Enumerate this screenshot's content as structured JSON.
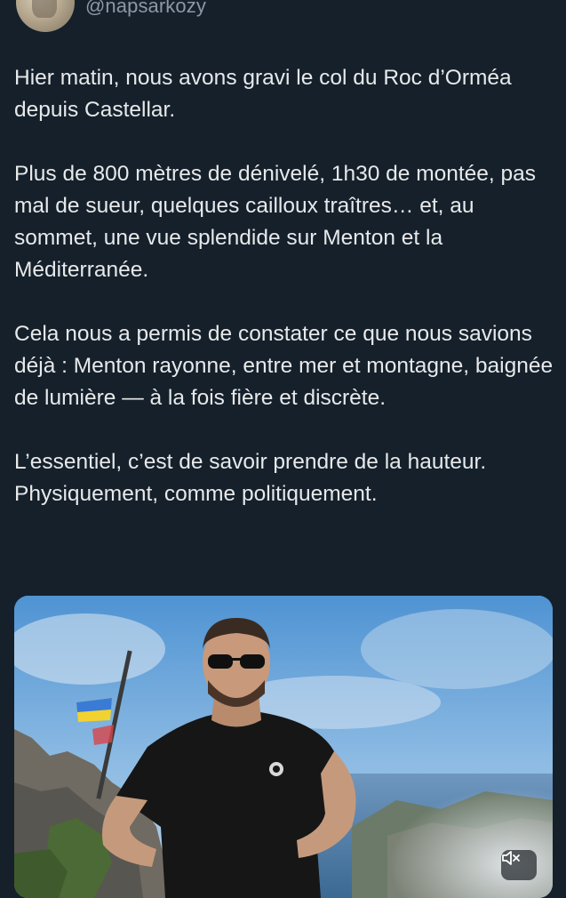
{
  "author": {
    "handle": "@napsarkozy",
    "avatar_icon": "profile-avatar"
  },
  "tweet": {
    "paragraphs": [
      "Hier matin, nous avons gravi le col du Roc d’Orméa depuis Castellar.",
      "Plus de 800 mètres de dénivelé, 1h30 de montée, pas mal de sueur, quelques cailloux traîtres… et, au sommet, une vue splendide sur Menton et la Méditerranée.",
      "Cela nous a permis de constater ce que nous savions déjà : Menton rayonne, entre mer et montagne, baignée de lumière — à la fois fière et discrète.",
      "L’essentiel, c’est de savoir prendre de la hauteur. Physiquement, comme politiquement."
    ]
  },
  "media": {
    "type": "video",
    "mute_icon": "volume-muted-icon",
    "colors": {
      "sky": "#5f9fd6",
      "sea": "#3f6f9c",
      "shirt": "#161616",
      "rock": "#6d6a62"
    }
  },
  "theme": {
    "background": "#15202b",
    "text": "#e7e9ea",
    "secondary_text": "#8b98a5"
  }
}
